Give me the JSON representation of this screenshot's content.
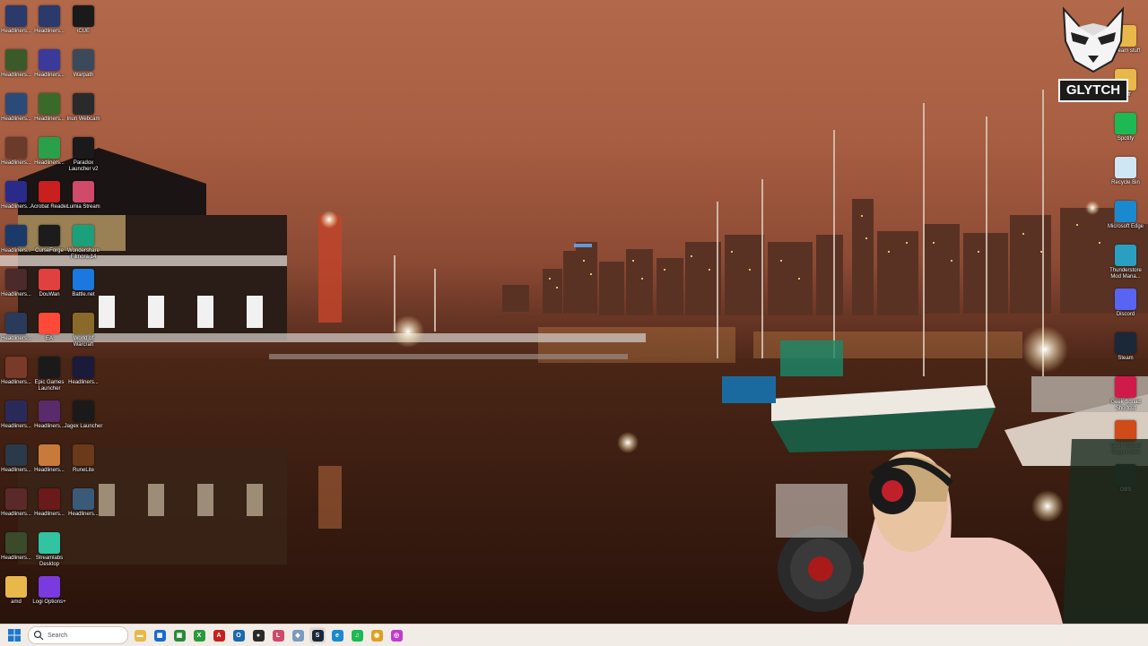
{
  "desktop": {
    "icons_col1": [
      {
        "label": "Headliners...",
        "icon": "headliners-icon",
        "color": "#2a3a6a"
      },
      {
        "label": "Headliners...",
        "icon": "headliners-icon",
        "color": "#3b5a2a"
      },
      {
        "label": "Headliners...",
        "icon": "headliners-icon",
        "color": "#2a4a7a"
      },
      {
        "label": "Headliners...",
        "icon": "headliners-icon",
        "color": "#6a3a2a"
      },
      {
        "label": "Headliners...",
        "icon": "headliners-icon",
        "color": "#2a2a8a"
      },
      {
        "label": "Headliners...",
        "icon": "headliners-icon",
        "color": "#1a3a6a"
      },
      {
        "label": "Headliners...",
        "icon": "headliners-icon",
        "color": "#4a2a2a"
      },
      {
        "label": "Headliners...",
        "icon": "headliners-icon",
        "color": "#2a3a5a"
      },
      {
        "label": "Headliners...",
        "icon": "headliners-icon",
        "color": "#7a3a2a"
      },
      {
        "label": "Headliners...",
        "icon": "headliners-icon",
        "color": "#2a2a5a"
      },
      {
        "label": "Headliners...",
        "icon": "headliners-icon",
        "color": "#2a3a4a"
      },
      {
        "label": "Headliners...",
        "icon": "headliners-icon",
        "color": "#5a2a2a"
      },
      {
        "label": "Headliners...",
        "icon": "headliners-icon",
        "color": "#3a4a2a"
      },
      {
        "label": "amd",
        "icon": "folder-icon",
        "color": "#e8b84a"
      }
    ],
    "icons_col2": [
      {
        "label": "Headliners...",
        "icon": "headliners-icon",
        "color": "#2a3a6a"
      },
      {
        "label": "Headliners...",
        "icon": "headliners-icon",
        "color": "#3a3a9a"
      },
      {
        "label": "Headliners...",
        "icon": "headliners-icon",
        "color": "#3a6a2a"
      },
      {
        "label": "Headliners...",
        "icon": "headliners-icon",
        "color": "#2aa04a"
      },
      {
        "label": "Acrobat Reader",
        "icon": "acrobat-icon",
        "color": "#c8201e"
      },
      {
        "label": "CurseForge",
        "icon": "curseforge-icon",
        "color": "#1c1c1c"
      },
      {
        "label": "DouWan",
        "icon": "douwan-icon",
        "color": "#e04040"
      },
      {
        "label": "EA",
        "icon": "ea-icon",
        "color": "#ff4a3a"
      },
      {
        "label": "Epic Games Launcher",
        "icon": "epic-games-icon",
        "color": "#1a1a1a"
      },
      {
        "label": "Headliners...",
        "icon": "headliners-icon",
        "color": "#5a2a6a"
      },
      {
        "label": "Headliners...",
        "icon": "headliners-icon",
        "color": "#c87a3a"
      },
      {
        "label": "Headliners...",
        "icon": "headliners-icon",
        "color": "#6a1a1a"
      },
      {
        "label": "Streamlabs Desktop",
        "icon": "streamlabs-icon",
        "color": "#31c3a2"
      },
      {
        "label": "Logi Options+",
        "icon": "logi-options-icon",
        "color": "#7a3ae0"
      }
    ],
    "icons_col3": [
      {
        "label": "iCUE",
        "icon": "icue-icon",
        "color": "#1a1a1a"
      },
      {
        "label": "Warpath",
        "icon": "warpath-icon",
        "color": "#3a4a5a"
      },
      {
        "label": "Inun Webcam",
        "icon": "webcam-icon",
        "color": "#2a2a2a"
      },
      {
        "label": "Paradox Launcher v2",
        "icon": "paradox-icon",
        "color": "#1a1a1a"
      },
      {
        "label": "Lumia Stream",
        "icon": "lumia-stream-icon",
        "color": "#d04a6a"
      },
      {
        "label": "Wondershare Filmora 14",
        "icon": "filmora-icon",
        "color": "#1aa07a"
      },
      {
        "label": "Battle.net",
        "icon": "battlenet-icon",
        "color": "#1a78e0"
      },
      {
        "label": "World of Warcraft",
        "icon": "wow-icon",
        "color": "#8a6a2a"
      },
      {
        "label": "Headliners...",
        "icon": "headliners-icon",
        "color": "#1a1a3a"
      },
      {
        "label": "Jagex Launcher",
        "icon": "jagex-icon",
        "color": "#1a1a1a"
      },
      {
        "label": "RuneLite",
        "icon": "runelite-icon",
        "color": "#6a3a1a"
      },
      {
        "label": "Headliners...",
        "icon": "headliners-icon",
        "color": "#3a5a7a"
      }
    ],
    "icons_right": [
      {
        "label": "Stream stuff",
        "icon": "folder-icon",
        "color": "#e8b84a"
      },
      {
        "label": "stuff",
        "icon": "folder-icon",
        "color": "#e8b84a"
      },
      {
        "label": "Spotify",
        "icon": "spotify-icon",
        "color": "#1db954"
      },
      {
        "label": "Recycle Bin",
        "icon": "recycle-bin-icon",
        "color": "#cfe6f5"
      },
      {
        "label": "Microsoft Edge",
        "icon": "edge-icon",
        "color": "#1a8ad0"
      },
      {
        "label": "Thunderstore Mod Mana...",
        "icon": "thunderstore-icon",
        "color": "#2aa0c0"
      },
      {
        "label": "Discord",
        "icon": "discord-icon",
        "color": "#5865f2"
      },
      {
        "label": "Steam",
        "icon": "steam-icon",
        "color": "#1b2838"
      },
      {
        "label": "Geek Squad Shortcut",
        "icon": "geek-squad-icon",
        "color": "#d01a4a"
      },
      {
        "label": "Geek Squad Support.exe",
        "icon": "geek-squad-icon",
        "color": "#d04a1a"
      },
      {
        "label": "OBS",
        "icon": "obs-icon",
        "color": "#2a2a2a"
      }
    ]
  },
  "overlay": {
    "brand": "GLYTCH"
  },
  "taskbar": {
    "search_placeholder": "Search",
    "apps": [
      {
        "name": "file-explorer-icon",
        "color": "#e8b84a",
        "glyph": "▬"
      },
      {
        "name": "store-icon",
        "color": "#1a6ad0",
        "glyph": "▦"
      },
      {
        "name": "terminal-icon",
        "color": "#2a8a3a",
        "glyph": "▣"
      },
      {
        "name": "xbox-icon",
        "color": "#2a9a3a",
        "glyph": "X"
      },
      {
        "name": "acrobat-icon",
        "color": "#c8201e",
        "glyph": "A"
      },
      {
        "name": "outlook-icon",
        "color": "#1a6ab0",
        "glyph": "O"
      },
      {
        "name": "obs-icon",
        "color": "#2a2a2a",
        "glyph": "●"
      },
      {
        "name": "lumia-stream-icon",
        "color": "#d04a6a",
        "glyph": "L"
      },
      {
        "name": "network-icon",
        "color": "#7a9ac0",
        "glyph": "◆"
      },
      {
        "name": "steam-icon",
        "color": "#1b2838",
        "glyph": "S"
      },
      {
        "name": "edge-icon",
        "color": "#1a8ad0",
        "glyph": "e"
      },
      {
        "name": "spotify-icon",
        "color": "#1db954",
        "glyph": "♫"
      },
      {
        "name": "chrome-icon",
        "color": "#e0a020",
        "glyph": "◉"
      },
      {
        "name": "streamlabs-icon",
        "color": "#c03ad0",
        "glyph": "◎"
      }
    ]
  }
}
